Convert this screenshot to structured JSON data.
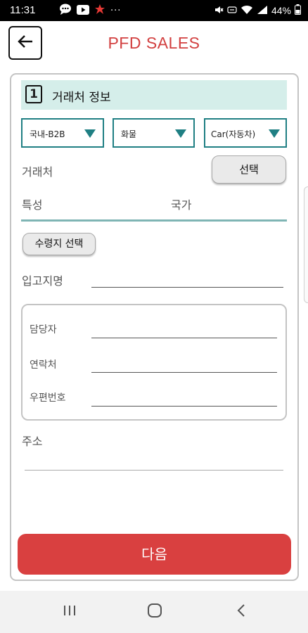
{
  "status_bar": {
    "time": "11:31",
    "more": "···",
    "battery": "44%",
    "icons": [
      "message-icon",
      "youtube-icon",
      "app-notification-icon",
      "mute-icon",
      "volte-icon",
      "wifi-icon",
      "signal-icon",
      "battery-icon"
    ]
  },
  "header": {
    "title": "PFD SALES",
    "back_icon": "arrow-left-icon"
  },
  "section": {
    "number": "1",
    "title": "거래처 정보"
  },
  "dropdowns": [
    {
      "value": "국내-B2B"
    },
    {
      "value": "화물"
    },
    {
      "value": "Car(자동차)"
    }
  ],
  "form": {
    "client_label": "거래처",
    "select_button": "선택",
    "trait_label": "특성",
    "country_label": "국가",
    "recipient_button": "수령지 선택",
    "warehouse_label": "입고지명",
    "contact": {
      "manager_label": "담당자",
      "phone_label": "연락처",
      "postal_label": "우편번호"
    },
    "address_label": "주소"
  },
  "actions": {
    "next_button": "다음"
  },
  "nav": {
    "icons": [
      "recent-apps-icon",
      "home-icon",
      "back-nav-icon"
    ]
  },
  "colors": {
    "accent_red": "#d94040",
    "teal": "#1f7f83",
    "header_bg": "#d5eeea"
  }
}
